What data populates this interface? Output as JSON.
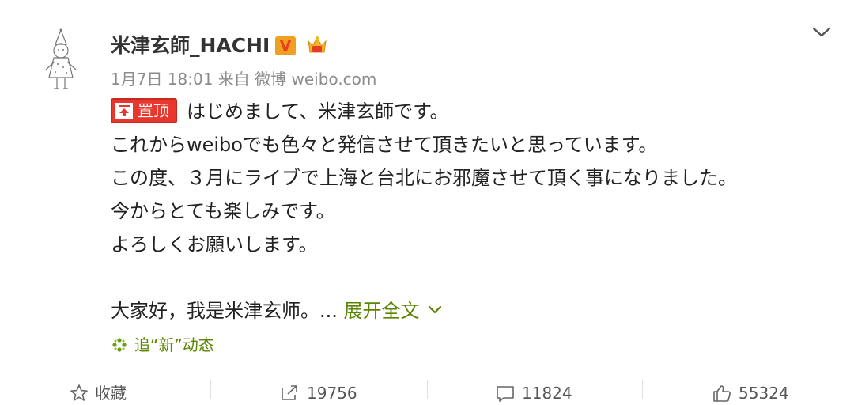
{
  "post": {
    "username": "米津玄師_HACHI",
    "verified_badge": "V",
    "meta": "1月7日 18:01 来自 微博 weibo.com",
    "pin_label": "置顶",
    "lines": [
      "はじめまして、米津玄師です。",
      "これからweiboでも色々と発信させて頂きたいと思っています。",
      "この度、３月にライブで上海と台北にお邪魔させて頂く事になりました。",
      "今からとても楽しみです。",
      "よろしくお願いします。"
    ],
    "chinese_text": "大家好，我是米津玄师。...",
    "expand_label": "展开全文",
    "track_label": "追“新”动态"
  },
  "actions": {
    "favorite": "收藏",
    "repost": "19756",
    "comment": "11824",
    "like": "55324"
  },
  "colors": {
    "accent_green": "#5b8400",
    "pin_red": "#e8372c",
    "badge_orange": "#f0a020"
  },
  "icons": [
    "avatar-illustration",
    "verified-v-icon",
    "crown-badge-icon",
    "chevron-down-icon",
    "pin-top-icon",
    "sparkle-icon",
    "star-icon",
    "repost-icon",
    "comment-icon",
    "thumbs-up-icon"
  ]
}
